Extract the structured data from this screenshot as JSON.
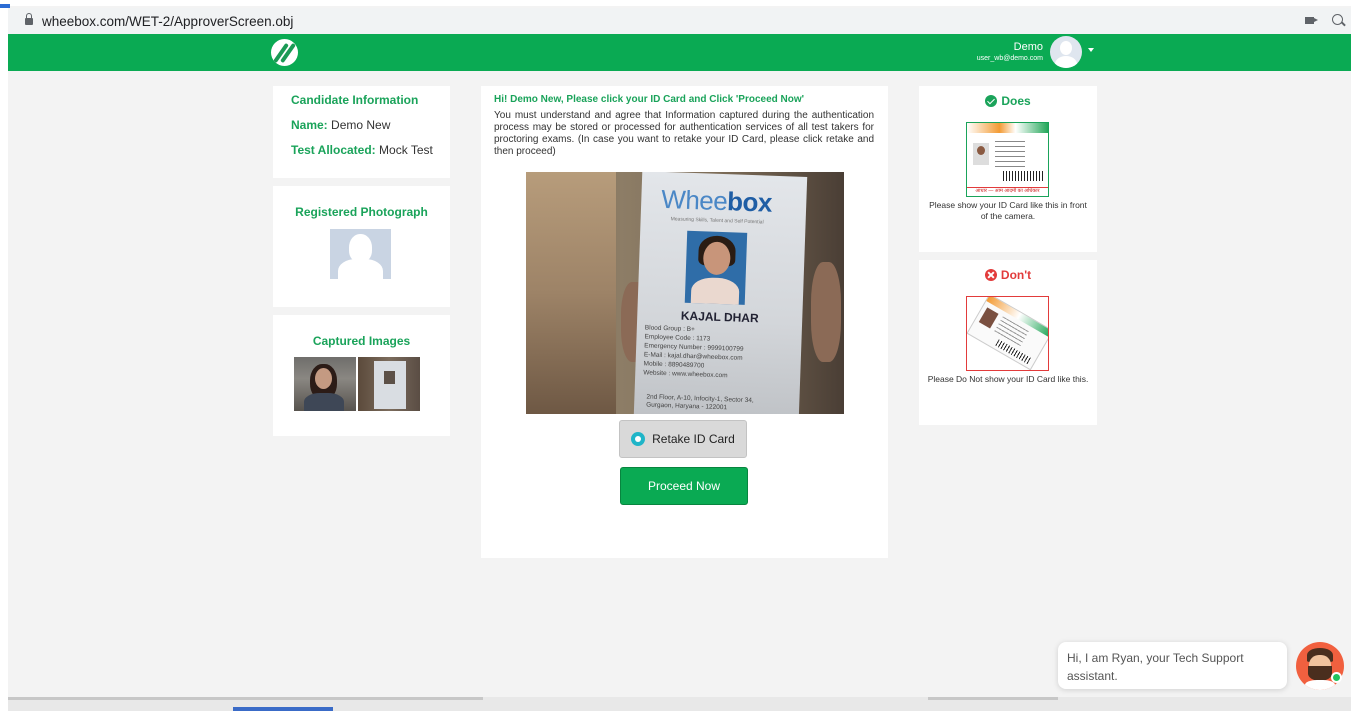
{
  "browser": {
    "url": "wheebox.com/WET-2/ApproverScreen.obj"
  },
  "header": {
    "user_name": "Demo",
    "user_email": "user_wb@demo.com"
  },
  "candidate": {
    "title": "Candidate Information",
    "name_label": "Name:",
    "name_value": "Demo New",
    "test_label": "Test Allocated:",
    "test_value": "Mock Test"
  },
  "registered_photo": {
    "title": "Registered Photograph"
  },
  "captured": {
    "title": "Captured Images"
  },
  "main": {
    "heading": "Hi! Demo New, Please click your ID Card and Click 'Proceed Now'",
    "instructions": "You must understand and agree that Information captured during the authentication process may be stored or processed for authentication services of all test takers for proctoring exams. (In case you want to retake your ID Card, please click retake and then proceed)",
    "retake_label": "Retake ID Card",
    "proceed_label": "Proceed Now"
  },
  "id_card": {
    "logo_text_a": "Whee",
    "logo_text_b": "box",
    "tagline": "Measuring Skills, Talent and Self Potential",
    "name": "KAJAL DHAR",
    "details": [
      "Blood Group : B+",
      "Employee Code : 1173",
      "Emergency Number : 9999100799",
      "E-Mail : kajal.dhar@wheebox.com",
      "Mobile : 8890489700",
      "Website : www.wheebox.com"
    ],
    "address": [
      "2nd Floor, A-10, Infocity-1, Sector 34,",
      "Gurgaon, Haryana - 122001"
    ]
  },
  "does": {
    "title": "Does",
    "caption": "Please show your ID Card like this in front of the camera.",
    "card_footer": "आधार — आम आदमी का अधिकार"
  },
  "dont": {
    "title": "Don't",
    "caption": "Please Do Not show your ID Card like this."
  },
  "chat": {
    "message": "Hi, I am Ryan, your Tech Support assistant."
  },
  "colors": {
    "brand_green": "#0aaa53",
    "label_green": "#1aa35a",
    "danger_red": "#e23b3b",
    "page_bg": "#f3f3f3"
  }
}
